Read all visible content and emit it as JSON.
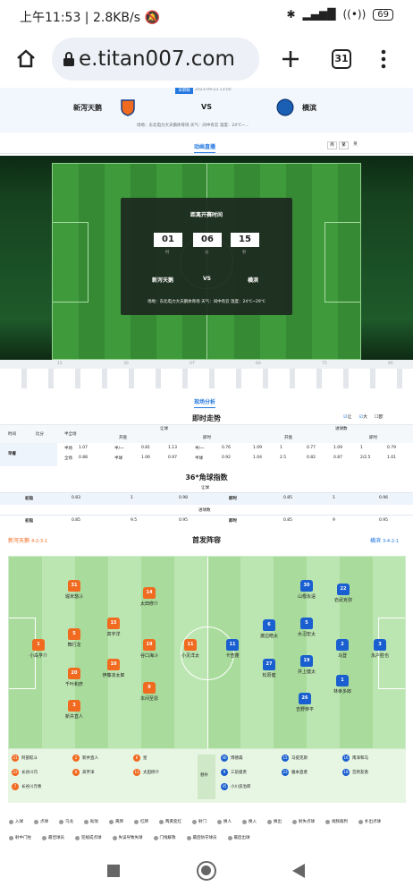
{
  "status": {
    "time": "上午11:53",
    "speed": "2.8KB/s",
    "battery": "69"
  },
  "browser": {
    "url": "e.titan007.com",
    "tabs": "31"
  },
  "match": {
    "home": "新泻天鹅",
    "away": "横滨",
    "vs": "VS",
    "round": "日职联",
    "datetime": "2023-09-23 13:00",
    "info": "场地：东北电力大天鹅体育场   天气：间中有云   温度：24℃~..."
  },
  "tabs": {
    "live": "动画直播",
    "t1": "简",
    "t2": "繁",
    "t3": "英"
  },
  "countdown": {
    "title": "距离开赛时间",
    "h": "01",
    "m": "06",
    "s": "15",
    "hl": "时",
    "ml": "分",
    "sl": "秒",
    "home": "新泻天鹅",
    "vs": "VS",
    "away": "横滨",
    "info": "场地：东北电力大天鹅体育场 天气：间中有云 温度：24℃~29℃"
  },
  "timeline": [
    "15",
    "30",
    "HT",
    "60",
    "75",
    "90"
  ],
  "analysis": "现场分析",
  "odds": {
    "title": "即时走势",
    "legend": [
      "让",
      "大",
      "欧"
    ],
    "h_rq": "让球",
    "h_dx": "进球数",
    "col_time": "时间",
    "col_score": "比分",
    "col_ht": "半全场",
    "kp": "开盘",
    "js": "即时",
    "zc": "早餐",
    "r1": {
      "lbl": "半场",
      "v": [
        "1.07",
        "半/一",
        "0.81",
        "1.13",
        "半/一",
        "0.76",
        "1.09",
        "1",
        "0.77",
        "1.09",
        "1",
        "0.79"
      ]
    },
    "r2": {
      "lbl": "全场",
      "v": [
        "0.88",
        "半球",
        "1.06",
        "0.97",
        "半球",
        "0.92",
        "1.04",
        "2.5",
        "0.82",
        "0.87",
        "2/2.5",
        "1.01"
      ]
    }
  },
  "corner": {
    "title": "36*角球指数",
    "rq": "让球",
    "dx": "进球数",
    "cp": "初指",
    "js": "即时",
    "r1": [
      "0.83",
      "1",
      "0.98",
      "即时",
      "0.85",
      "1",
      "0.96"
    ],
    "r2": [
      "0.85",
      "9.5",
      "0.95",
      "即时",
      "0.85",
      "9",
      "0.95"
    ]
  },
  "lineup": {
    "title": "首发阵容",
    "home": "新泻天鹅",
    "home_f": "4-2-3-1",
    "away": "横滨",
    "away_f": "3-4-2-1"
  },
  "home_players": [
    {
      "n": "1",
      "name": "小岛亨介"
    },
    {
      "n": "31",
      "name": "堀米悠斗"
    },
    {
      "n": "5",
      "name": "舞行龙"
    },
    {
      "n": "20",
      "name": "千叶和彦"
    },
    {
      "n": "3",
      "name": "新井直人"
    },
    {
      "n": "15",
      "name": "高宇洋"
    },
    {
      "n": "10",
      "name": "伊藤凉太郎"
    },
    {
      "n": "14",
      "name": "太田修介"
    },
    {
      "n": "19",
      "name": "谷口海斗"
    },
    {
      "n": "9",
      "name": "本间至恩"
    },
    {
      "n": "11",
      "name": "小见洋太"
    }
  ],
  "away_players": [
    {
      "n": "30",
      "name": "山根永遠"
    },
    {
      "n": "22",
      "name": "岩武克弥"
    },
    {
      "n": "5",
      "name": "水沼宏太"
    },
    {
      "n": "2",
      "name": "马登"
    },
    {
      "n": "19",
      "name": "井上健太"
    },
    {
      "n": "6",
      "name": "渡边皓太"
    },
    {
      "n": "27",
      "name": "松原健"
    },
    {
      "n": "3",
      "name": "永户胜也"
    },
    {
      "n": "26",
      "name": "吉野恭平"
    },
    {
      "n": "11",
      "name": "卡查蓬"
    },
    {
      "n": "1",
      "name": "林幸多郎"
    }
  ],
  "subs_home": [
    {
      "n": "21",
      "name": "阿部航斗"
    },
    {
      "n": "2",
      "name": "新井直人"
    },
    {
      "n": "6",
      "name": "星"
    },
    {
      "n": "22",
      "name": "长谷川巧"
    },
    {
      "n": "8",
      "name": "高宇洋"
    },
    {
      "n": "11",
      "name": "太田修介"
    },
    {
      "n": "7",
      "name": "长谷川元希"
    }
  ],
  "subs_away": [
    {
      "n": "40",
      "name": "博德森"
    },
    {
      "n": "15",
      "name": "马提克斯"
    },
    {
      "n": "16",
      "name": "南泽和马"
    },
    {
      "n": "9",
      "name": "三前俊贵"
    },
    {
      "n": "23",
      "name": "雅本直者"
    },
    {
      "n": "18",
      "name": "宫原友香"
    },
    {
      "n": "45",
      "name": "小川良治郎"
    }
  ],
  "subs_label": "替补",
  "legend": [
    "入球",
    "点球",
    "乌龙",
    "助攻",
    "黄牌",
    "红牌",
    "两黄变红",
    "射门",
    "换人",
    "换入",
    "换出",
    "射失点球",
    "视频裁判",
    "扑出点球",
    "射中门柱",
    "最佳球员",
    "犯规成点球",
    "失误导致失球",
    "门线解救",
    "最后防守球员",
    "最后出球"
  ]
}
